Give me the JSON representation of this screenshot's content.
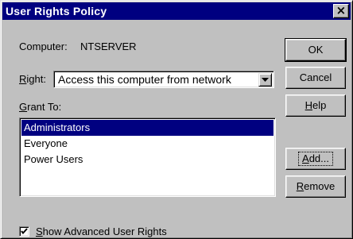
{
  "window": {
    "title": "User Rights Policy",
    "close_glyph": "×"
  },
  "computer": {
    "label": "Computer:",
    "value": "NTSERVER"
  },
  "right": {
    "label_access": "R",
    "label_rest": "ight:",
    "selected": "Access this computer from network"
  },
  "grant_to": {
    "label_access": "G",
    "label_rest": "rant To:",
    "items": [
      {
        "label": "Administrators",
        "selected": true
      },
      {
        "label": "Everyone",
        "selected": false
      },
      {
        "label": "Power Users",
        "selected": false
      }
    ]
  },
  "buttons": {
    "ok": "OK",
    "cancel": "Cancel",
    "help_access": "H",
    "help_rest": "elp",
    "add_access": "A",
    "add_rest": "dd...",
    "remove_access": "R",
    "remove_rest": "emove"
  },
  "advanced": {
    "checked": true,
    "label_access": "S",
    "label_rest": "how Advanced User Rights"
  },
  "colors": {
    "titlebar": "#000080",
    "face": "#c0c0c0",
    "selection": "#000080"
  }
}
